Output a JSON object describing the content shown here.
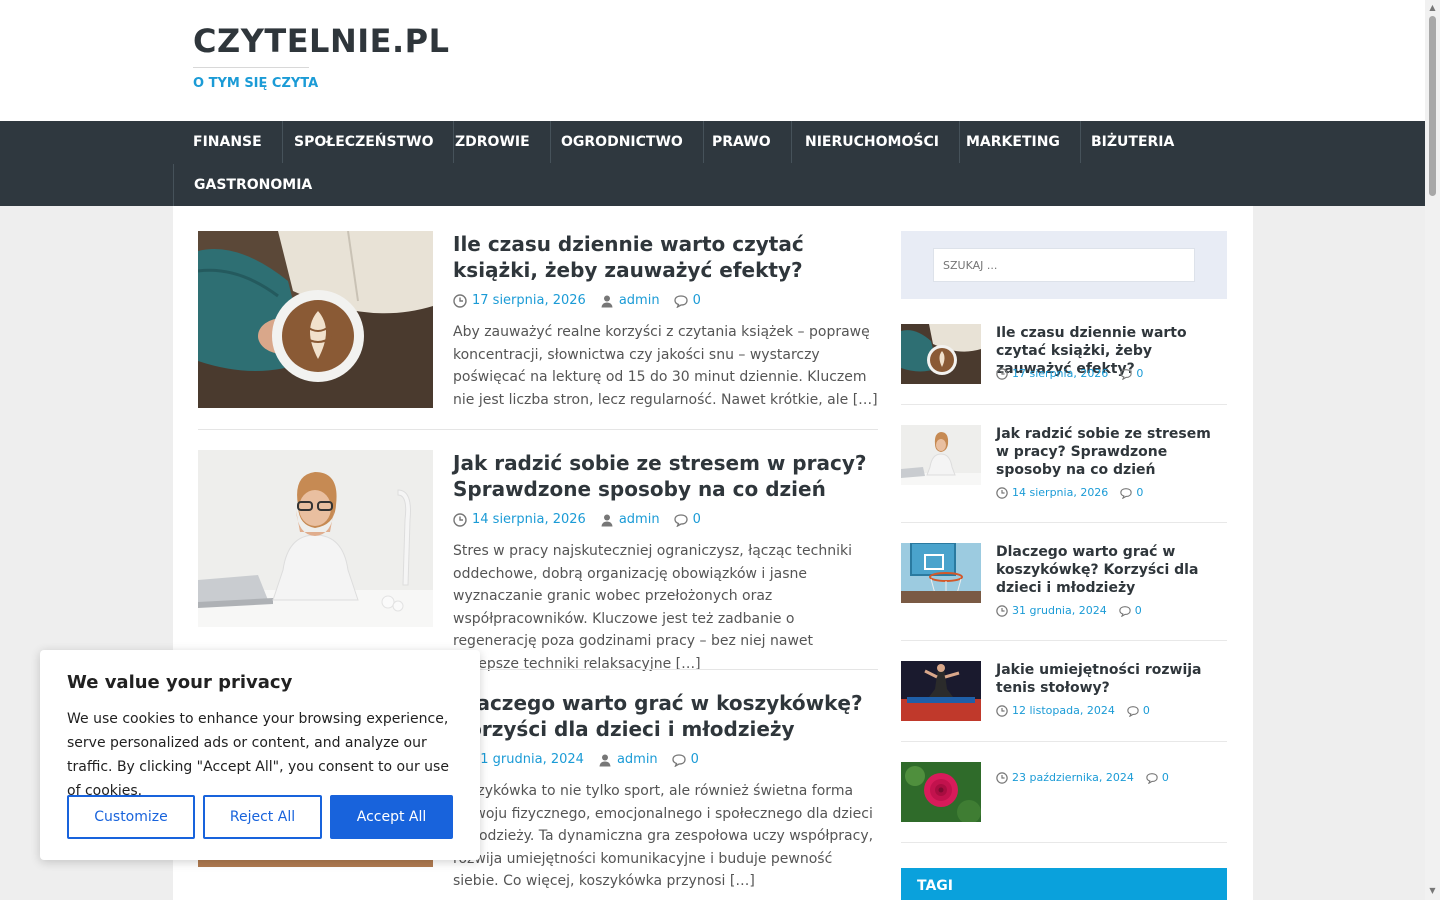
{
  "site": {
    "title": "CZYTELNIE.PL",
    "tagline": "O TYM SIĘ CZYTA"
  },
  "nav": {
    "items": [
      {
        "label": "FINANSE"
      },
      {
        "label": "SPOŁECZEŃSTWO"
      },
      {
        "label": "ZDROWIE"
      },
      {
        "label": "OGRODNICTWO"
      },
      {
        "label": "PRAWO"
      },
      {
        "label": "NIERUCHOMOŚCI"
      },
      {
        "label": "MARKETING"
      },
      {
        "label": "BIŻUTERIA"
      },
      {
        "label": "GASTRONOMIA"
      }
    ]
  },
  "posts": [
    {
      "title": "Ile czasu dziennie warto czytać książki, żeby zauważyć efekty?",
      "date": "17 sierpnia, 2026",
      "author": "admin",
      "comments": "0",
      "excerpt": "Aby zauważyć realne korzyści z czytania książek – poprawę koncentracji, słownictwa czy jakości snu – wystarczy poświęcać na lekturę od 15 do 30 minut dziennie. Kluczem nie jest liczba stron, lecz regularność. Nawet krótkie, ale",
      "more": "[…]"
    },
    {
      "title": "Jak radzić sobie ze stresem w pracy? Sprawdzone sposoby na co dzień",
      "date": "14 sierpnia, 2026",
      "author": "admin",
      "comments": "0",
      "excerpt": "Stres w pracy najskuteczniej ograniczysz, łącząc techniki oddechowe, dobrą organizację obowiązków i jasne wyznaczanie granic wobec przełożonych oraz współpracowników. Kluczowe jest też zadbanie o regenerację poza godzinami pracy – bez niej nawet najlepsze techniki relaksacyjne",
      "more": "[…]"
    },
    {
      "title": "Dlaczego warto grać w koszykówkę? Korzyści dla dzieci i młodzieży",
      "date": "31 grudnia, 2024",
      "author": "admin",
      "comments": "0",
      "excerpt": "Koszykówka to nie tylko sport, ale również świetna forma rozwoju fizycznego, emocjonalnego i społecznego dla dzieci i młodzieży. Ta dynamiczna gra zespołowa uczy współpracy, rozwija umiejętności komunikacyjne i buduje pewność siebie. Co więcej, koszykówka przynosi",
      "more": "[…]"
    }
  ],
  "sidebar": {
    "search_placeholder": "SZUKAJ ...",
    "recent": [
      {
        "title": "Ile czasu dziennie warto czytać książki, żeby zauważyć efekty?",
        "date": "17 sierpnia, 2026",
        "comments": "0"
      },
      {
        "title": "Jak radzić sobie ze stresem w pracy? Sprawdzone sposoby na co dzień",
        "date": "14 sierpnia, 2026",
        "comments": "0"
      },
      {
        "title": "Dlaczego warto grać w koszykówkę? Korzyści dla dzieci i młodzieży",
        "date": "31 grudnia, 2024",
        "comments": "0"
      },
      {
        "title": "Jakie umiejętności rozwija tenis stołowy?",
        "date": "12 listopada, 2024",
        "comments": "0"
      },
      {
        "title": "",
        "date": "23 października, 2024",
        "comments": "0"
      }
    ],
    "tags_heading": "TAGI"
  },
  "cookie": {
    "title": "We value your privacy",
    "text": "We use cookies to enhance your browsing experience, serve personalized ads or content, and analyze our traffic. By clicking \"Accept All\", you consent to our use of cookies.",
    "customize": "Customize",
    "reject": "Reject All",
    "accept": "Accept All"
  },
  "colors": {
    "accent": "#1b9bd6",
    "nav_bg": "#2f383f",
    "tags_bg": "#0aa1dc",
    "cookie_button": "#1863dc"
  }
}
